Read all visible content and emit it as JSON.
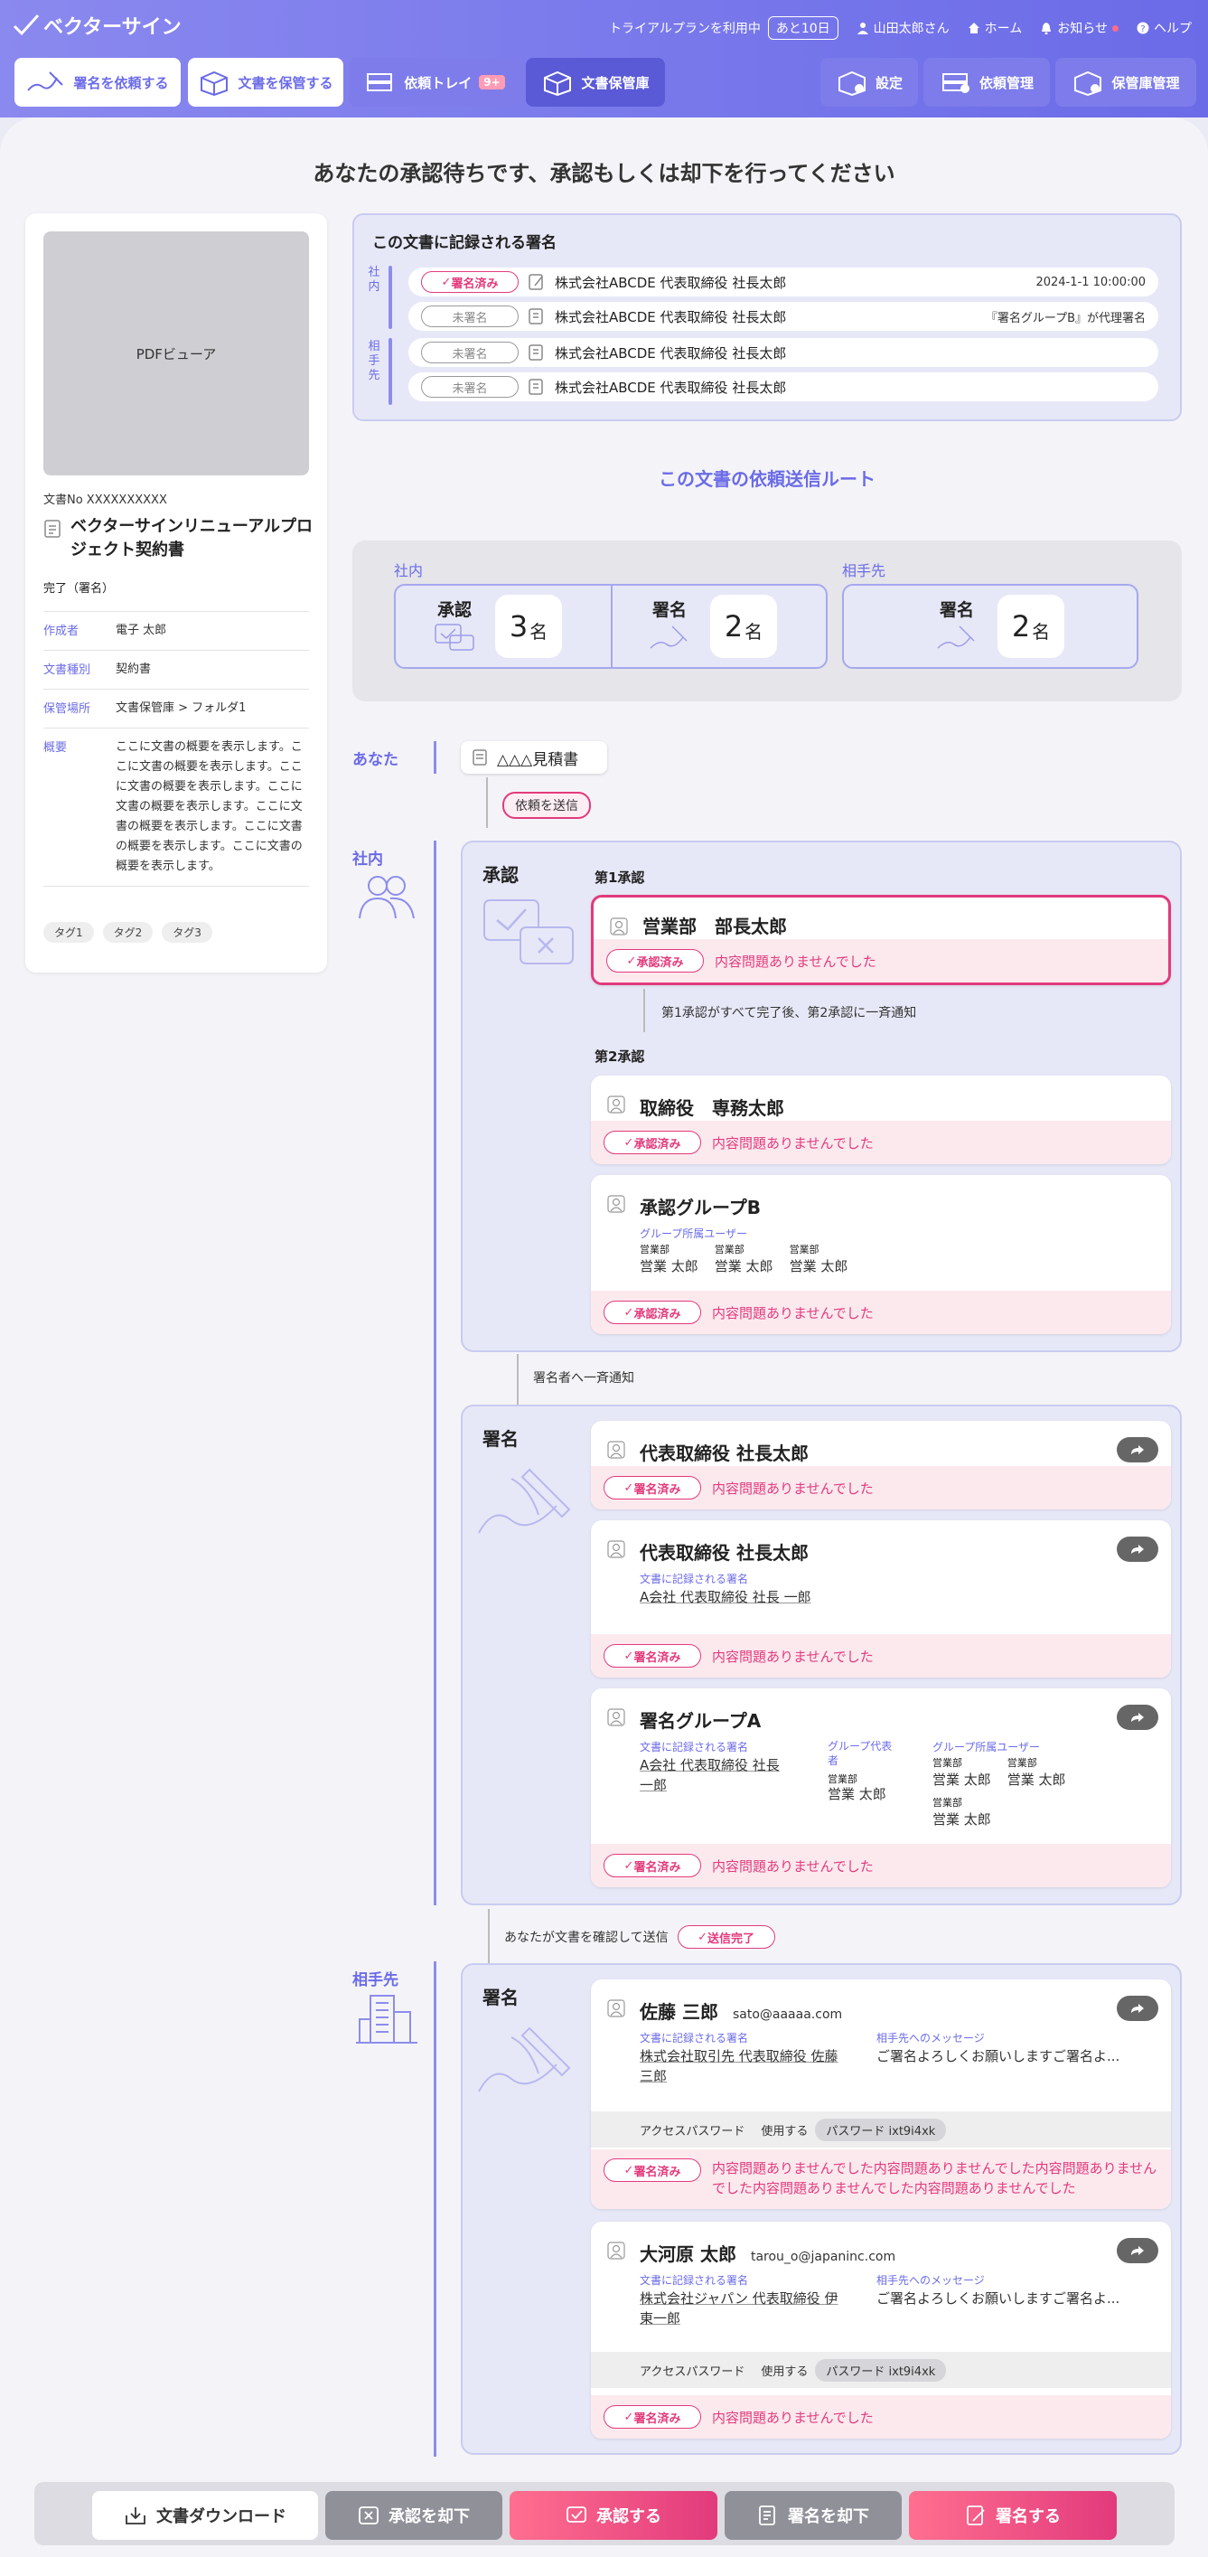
{
  "header": {
    "logo_text": "ベクターサイン",
    "trial_text": "トライアルプランを利用中",
    "trial_badge": "あと10日",
    "user_name": "山田太郎さん",
    "home_label": "ホーム",
    "notice_label": "お知らせ",
    "help_label": "ヘルプ"
  },
  "nav": {
    "request_sign": "署名を依頼する",
    "store_doc": "文書を保管する",
    "request_tray": "依頼トレイ",
    "request_tray_badge": "9+",
    "doc_storage": "文書保管庫",
    "settings": "設定",
    "request_manage": "依頼管理",
    "storage_manage": "保管庫管理"
  },
  "page_title": "あなたの承認待ちです、承認もしくは却下を行ってください",
  "doc": {
    "pdf_viewer": "PDFビューア",
    "doc_no": "文書No XXXXXXXXXX",
    "title": "ベクターサインリニューアルプロジェクト契約書",
    "status": "完了（署名）",
    "info": [
      {
        "k": "作成者",
        "v": "電子 太郎"
      },
      {
        "k": "文書種別",
        "v": "契約書"
      },
      {
        "k": "保管場所",
        "v": "文書保管庫 > フォルダ1"
      },
      {
        "k": "概要",
        "v": "ここに文書の概要を表示します。ここに文書の概要を表示します。ここに文書の概要を表示します。ここに文書の概要を表示します。ここに文書の概要を表示します。ここに文書の概要を表示します。ここに文書の概要を表示します。"
      }
    ],
    "tags": [
      "タグ1",
      "タグ2",
      "タグ3"
    ]
  },
  "signatures": {
    "heading": "この文書に記録される署名",
    "internal_label": "社内",
    "partner_label": "相手先",
    "rows": [
      {
        "status": "署名済み",
        "name": "株式会社ABCDE 代表取締役 社長太郎",
        "right": "2024-1-1 10:00:00"
      },
      {
        "status": "未署名",
        "name": "株式会社ABCDE 代表取締役 社長太郎",
        "right": "『署名グループB』が代理署名"
      },
      {
        "status": "未署名",
        "name": "株式会社ABCDE 代表取締役 社長太郎",
        "right": ""
      },
      {
        "status": "未署名",
        "name": "株式会社ABCDE 代表取締役 社長太郎",
        "right": ""
      }
    ]
  },
  "route_title": "この文書の依頼送信ルート",
  "summary": {
    "internal_label": "社内",
    "partner_label": "相手先",
    "approve_label": "承認",
    "approve_count": "3",
    "sign_label": "署名",
    "sign_count": "2",
    "partner_sign_label": "署名",
    "partner_sign_count": "2",
    "unit": "名"
  },
  "route": {
    "you_label": "あなた",
    "doc_chip": "△△△見積書",
    "send_tag": "依頼を送信",
    "internal_label": "社内",
    "partner_label": "相手先",
    "approve_section": "承認",
    "step1": "第1承認",
    "step1_notice": "第1承認がすべて完了後、第2承認に一斉通知",
    "step2": "第2承認",
    "sign_notice": "署名者へ一斉通知",
    "sign_section": "署名",
    "partner_sign_section": "署名",
    "you_send_notice": "あなたが文書を確認して送信",
    "send_done": "送信完了",
    "approved_label": "承認済み",
    "signed_label": "署名済み",
    "no_problem": "内容問題ありませんでした",
    "recorded_sig_label": "文書に記録される署名",
    "group_rep_label": "グループ代表者",
    "group_users_label": "グループ所属ユーザー",
    "message_label": "相手先へのメッセージ",
    "access_pw_label": "アクセスパスワード",
    "use_label": "使用する",
    "pw_chip": "パスワード ixt9i4xk",
    "approvers": [
      {
        "name": "営業部　部長太郎"
      },
      {
        "name": "取締役　専務太郎"
      },
      {
        "name": "承認グループB"
      }
    ],
    "group_b_users": [
      {
        "dept": "営業部",
        "name": "営業 太郎"
      },
      {
        "dept": "営業部",
        "name": "営業 太郎"
      },
      {
        "dept": "営業部",
        "name": "営業 太郎"
      }
    ],
    "signers": [
      {
        "name": "代表取締役 社長太郎"
      },
      {
        "name": "代表取締役 社長太郎",
        "recorded": "A会社 代表取締役 社長 一郎"
      },
      {
        "name": "署名グループA",
        "recorded": "A会社 代表取締役 社長 一郎",
        "rep_dept": "営業部",
        "rep_name": "営業 太郎",
        "users": [
          {
            "dept": "営業部",
            "name": "営業 太郎"
          },
          {
            "dept": "営業部",
            "name": "営業 太郎"
          },
          {
            "dept": "営業部",
            "name": "営業 太郎"
          }
        ]
      }
    ],
    "partners": [
      {
        "name": "佐藤 三郎",
        "email": "sato@aaaaa.com",
        "recorded": "株式会社取引先 代表取締役 佐藤 三郎",
        "message": "ご署名よろしくお願いしますご署名よ...",
        "result": "内容問題ありませんでした内容問題ありませんでした内容問題ありませんでした内容問題ありませんでした内容問題ありませんでした"
      },
      {
        "name": "大河原 太郎",
        "email": "tarou_o@japaninc.com",
        "recorded": "株式会社ジャパン 代表取締役 伊東一郎",
        "message": "ご署名よろしくお願いしますご署名よ...",
        "result": "内容問題ありませんでした"
      }
    ]
  },
  "actions": {
    "download": "文書ダウンロード",
    "reject_approval": "承認を却下",
    "approve": "承認する",
    "reject_sign": "署名を却下",
    "sign": "署名する"
  },
  "colors": {
    "accent": "#6b6be8",
    "pink": "#e23a7c"
  }
}
